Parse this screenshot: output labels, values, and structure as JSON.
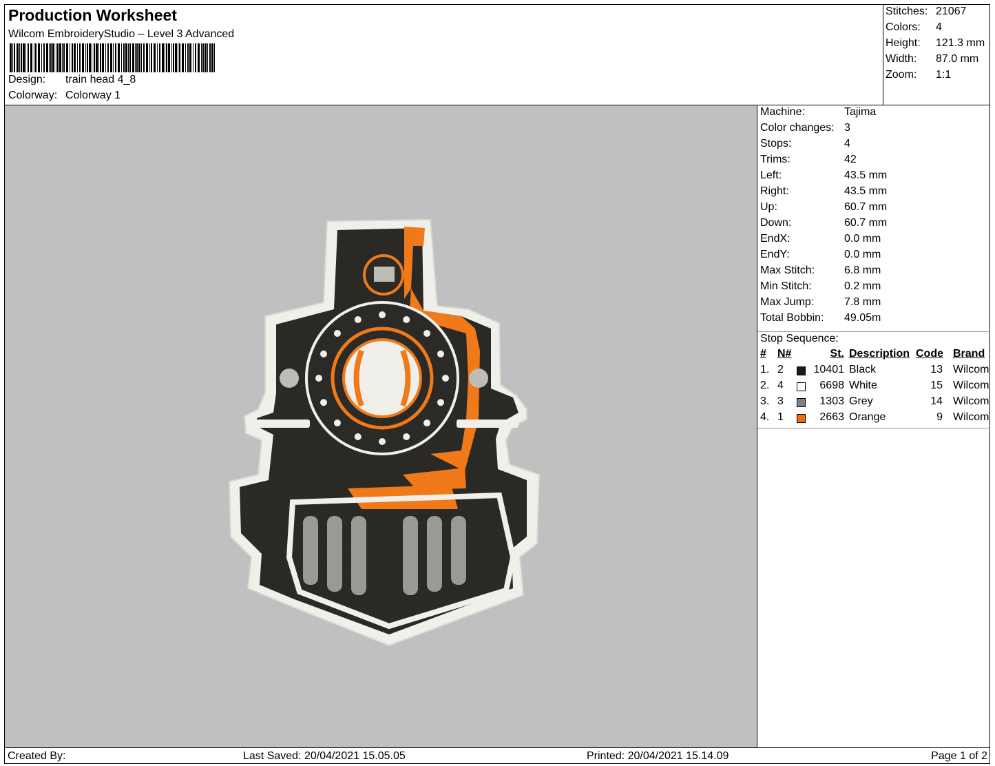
{
  "header": {
    "title": "Production Worksheet",
    "subtitle": "Wilcom EmbroideryStudio – Level 3 Advanced",
    "design_label": "Design:",
    "design_value": "train head 4_8",
    "colorway_label": "Colorway:",
    "colorway_value": "Colorway 1"
  },
  "summary": [
    {
      "label": "Stitches:",
      "value": "21067"
    },
    {
      "label": "Colors:",
      "value": "4"
    },
    {
      "label": "Height:",
      "value": "121.3 mm"
    },
    {
      "label": "Width:",
      "value": "87.0 mm"
    },
    {
      "label": "Zoom:",
      "value": "1:1"
    }
  ],
  "machine_info": [
    {
      "label": "Machine:",
      "value": "Tajima"
    },
    {
      "label": "Color changes:",
      "value": "3"
    },
    {
      "label": "Stops:",
      "value": "4"
    },
    {
      "label": "Trims:",
      "value": "42"
    },
    {
      "label": "Left:",
      "value": "43.5 mm"
    },
    {
      "label": "Right:",
      "value": "43.5 mm"
    },
    {
      "label": "Up:",
      "value": "60.7 mm"
    },
    {
      "label": "Down:",
      "value": "60.7 mm"
    },
    {
      "label": "EndX:",
      "value": "0.0 mm"
    },
    {
      "label": "EndY:",
      "value": "0.0 mm"
    },
    {
      "label": "Max Stitch:",
      "value": "6.8 mm"
    },
    {
      "label": "Min Stitch:",
      "value": "0.2 mm"
    },
    {
      "label": "Max Jump:",
      "value": "7.8 mm"
    },
    {
      "label": "Total Bobbin:",
      "value": "49.05m"
    }
  ],
  "stop_sequence": {
    "title": "Stop Sequence:",
    "headers": {
      "idx": "#",
      "n": "N#",
      "st": "St.",
      "desc": "Description",
      "code": "Code",
      "brand": "Brand"
    },
    "rows": [
      {
        "idx": "1.",
        "n": "2",
        "color": "#1a1a1a",
        "st": "10401",
        "desc": "Black",
        "code": "13",
        "brand": "Wilcom"
      },
      {
        "idx": "2.",
        "n": "4",
        "color": "#ffffff",
        "st": "6698",
        "desc": "White",
        "code": "15",
        "brand": "Wilcom"
      },
      {
        "idx": "3.",
        "n": "3",
        "color": "#808080",
        "st": "1303",
        "desc": "Grey",
        "code": "14",
        "brand": "Wilcom"
      },
      {
        "idx": "4.",
        "n": "1",
        "color": "#f06a10",
        "st": "2663",
        "desc": "Orange",
        "code": "9",
        "brand": "Wilcom"
      }
    ]
  },
  "footer": {
    "created_by": "Created By:",
    "last_saved": "Last Saved: 20/04/2021 15.05.05",
    "printed": "Printed: 20/04/2021 15.14.09",
    "page": "Page 1 of 2"
  }
}
